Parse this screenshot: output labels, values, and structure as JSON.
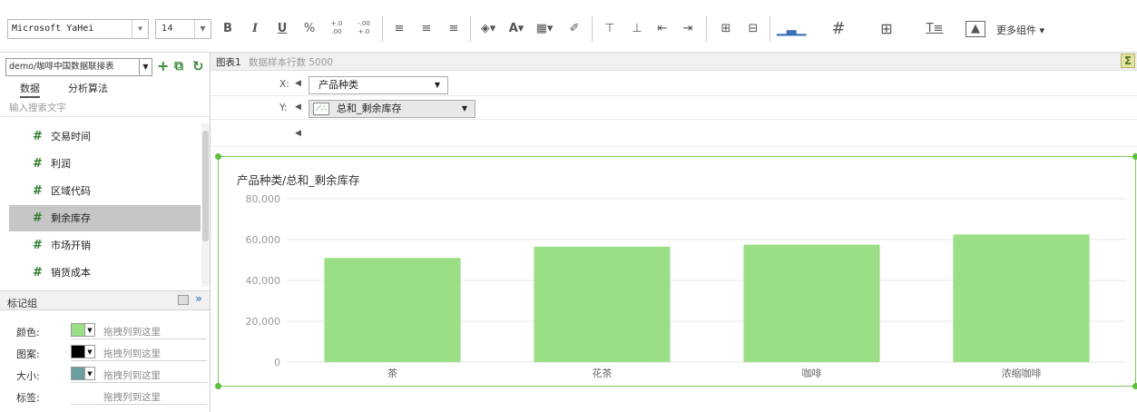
{
  "toolbar": {
    "font_value": "Microsoft YaHei",
    "size_value": "14",
    "bold": "B",
    "italic": "I",
    "underline": "U",
    "percent": "%",
    "decimal_add": "+.0 .00",
    "decimal_remove": "-.00 +.0",
    "more_widgets": "更多组件 ▾"
  },
  "source": {
    "value": "demo/咖啡中国数据联接表"
  },
  "left_tabs": {
    "data": "数据",
    "algo": "分析算法"
  },
  "search": {
    "placeholder": "输入搜索文字"
  },
  "fields": [
    {
      "label": "交易时间",
      "selected": false
    },
    {
      "label": "利润",
      "selected": false
    },
    {
      "label": "区域代码",
      "selected": false
    },
    {
      "label": "剩余库存",
      "selected": true
    },
    {
      "label": "市场开销",
      "selected": false
    },
    {
      "label": "销货成本",
      "selected": false
    }
  ],
  "field_icon": "#",
  "marks": {
    "title": "标记组",
    "rows": [
      {
        "label": "颜色:",
        "swatch": "#9ade86",
        "drop": "拖拽列到这里"
      },
      {
        "label": "图案:",
        "swatch": "#000000",
        "drop": "拖拽列到这里"
      },
      {
        "label": "大小:",
        "swatch": "#6b9ea0",
        "drop": "拖拽列到这里"
      },
      {
        "label": "标签:",
        "swatch": "",
        "drop": "拖拽列到这里"
      }
    ]
  },
  "chart_panel": {
    "name": "图表1",
    "sample_count": "数据样本行数 5000",
    "x_label": "X:",
    "x_value": "产品种类",
    "y_label": "Y:",
    "y_value": "总和_剩余库存"
  },
  "colors": {
    "bar": "#9ade86",
    "frame": "#7cc95c",
    "accent": "#2f7d2f"
  },
  "chart_data": {
    "type": "bar",
    "title": "产品种类/总和_剩余库存",
    "categories": [
      "茶",
      "花茶",
      "咖啡",
      "浓缩咖啡"
    ],
    "values": [
      51000,
      56500,
      57500,
      62500
    ],
    "ylim": [
      0,
      80000
    ],
    "yticks": [
      0,
      20000,
      40000,
      60000,
      80000
    ],
    "ytick_labels": [
      "0",
      "20,000",
      "40,000",
      "60,000",
      "80,000"
    ],
    "grid": true,
    "xlabel": "",
    "ylabel": ""
  }
}
